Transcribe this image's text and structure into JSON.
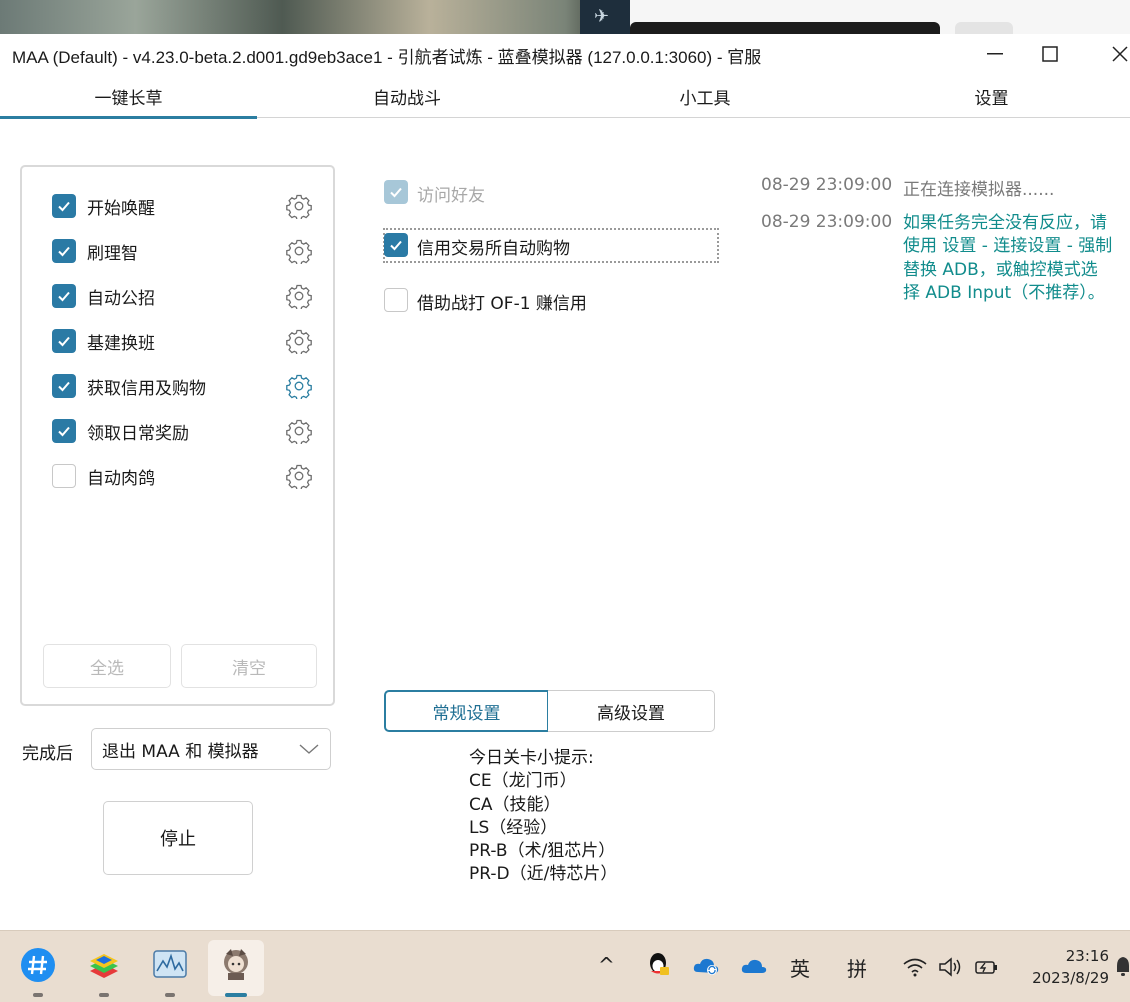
{
  "window": {
    "title": "MAA (Default) - v4.23.0-beta.2.d001.gd9eb3ace1 - 引航者试炼 - 蓝叠模拟器 (127.0.0.1:3060) - 官服",
    "controls": {
      "minimize": "—",
      "maximize": "☐",
      "close": "✕"
    }
  },
  "tabs": [
    {
      "label": "一键长草",
      "active": true
    },
    {
      "label": "自动战斗"
    },
    {
      "label": "小工具"
    },
    {
      "label": "设置"
    }
  ],
  "tasks": [
    {
      "label": "开始唤醒",
      "checked": true
    },
    {
      "label": "刷理智",
      "checked": true
    },
    {
      "label": "自动公招",
      "checked": true
    },
    {
      "label": "基建换班",
      "checked": true
    },
    {
      "label": "获取信用及购物",
      "checked": true,
      "selected": true
    },
    {
      "label": "领取日常奖励",
      "checked": true
    },
    {
      "label": "自动肉鸽",
      "checked": false
    }
  ],
  "task_buttons": {
    "select_all": "全选",
    "clear": "清空"
  },
  "after_completion": {
    "label": "完成后",
    "value": "退出 MAA 和 模拟器"
  },
  "stop_button": "停止",
  "options": [
    {
      "label": "访问好友",
      "checked": true,
      "disabled": true
    },
    {
      "label": "信用交易所自动购物",
      "checked": true
    },
    {
      "label": "借助战打 OF-1 赚信用",
      "checked": false
    }
  ],
  "settings_tabs": {
    "normal": "常规设置",
    "advanced": "高级设置"
  },
  "tips": {
    "heading": "今日关卡小提示:",
    "lines": [
      "CE（龙门币）",
      "CA（技能）",
      "LS（经验）",
      "PR-B（术/狙芯片）",
      "PR-D（近/特芯片）"
    ]
  },
  "log": [
    {
      "time": "08-29  23:09:00",
      "message": "正在连接模拟器......"
    },
    {
      "time": "08-29  23:09:00",
      "message": "如果任务完全没有反应，请使用 设置 - 连接设置 - 强制替换 ADB，或触控模式选择 ADB Input（不推荐）。",
      "color": "#118c8c"
    }
  ],
  "taskbar": {
    "tray": {
      "chevron": "^",
      "lang": "英",
      "ime": "拼"
    },
    "time": "23:16",
    "date": "2023/8/29"
  },
  "colors": {
    "accent": "#2b7ea1",
    "checkbox": "#2a7aa5",
    "warn_text": "#118c8c"
  }
}
